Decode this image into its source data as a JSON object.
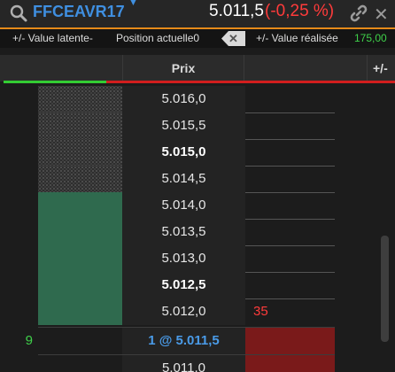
{
  "header": {
    "symbol": "FFCEAVR17",
    "price": "5.011,5",
    "change": "(-0,25 %)"
  },
  "info_bar": {
    "latente_label": "+/- Value latente-",
    "position_label": "Position actuelle0",
    "close_label": "✕",
    "realisee_label": "+/- Value réalisée",
    "realisee_value": "175,00"
  },
  "columns": {
    "left": "",
    "prix": "Prix",
    "right": "",
    "plus": "+/-"
  },
  "rows": [
    {
      "qty": "",
      "prix": "5.016,0",
      "ask": "",
      "bold": false
    },
    {
      "qty": "",
      "prix": "5.015,5",
      "ask": "",
      "bold": false
    },
    {
      "qty": "",
      "prix": "5.015,0",
      "ask": "",
      "bold": true
    },
    {
      "qty": "",
      "prix": "5.014,5",
      "ask": "",
      "bold": false
    },
    {
      "qty": "",
      "prix": "5.014,0",
      "ask": "",
      "bold": false
    },
    {
      "qty": "",
      "prix": "5.013,5",
      "ask": "",
      "bold": false
    },
    {
      "qty": "",
      "prix": "5.013,0",
      "ask": "",
      "bold": false
    },
    {
      "qty": "",
      "prix": "5.012,5",
      "ask": "",
      "bold": true
    },
    {
      "qty": "",
      "prix": "5.012,0",
      "ask": "35",
      "bold": false
    },
    {
      "qty": "9",
      "prix": "1 @ 5.011,5",
      "ask": "",
      "bold": true
    },
    {
      "qty": "",
      "prix": "5.011,0",
      "ask": "",
      "bold": false
    }
  ],
  "colors": {
    "accent_blue": "#3f8fe0",
    "negative_red": "#ff3b3b",
    "positive_green": "#3fd14a",
    "orange_line": "#e58a19",
    "bid_fill": "#2f6a4e",
    "ask_fill": "#7a1a1a"
  },
  "icons": [
    "search-icon",
    "chevron-down-icon",
    "link-icon",
    "close-icon",
    "clear-x-icon"
  ]
}
